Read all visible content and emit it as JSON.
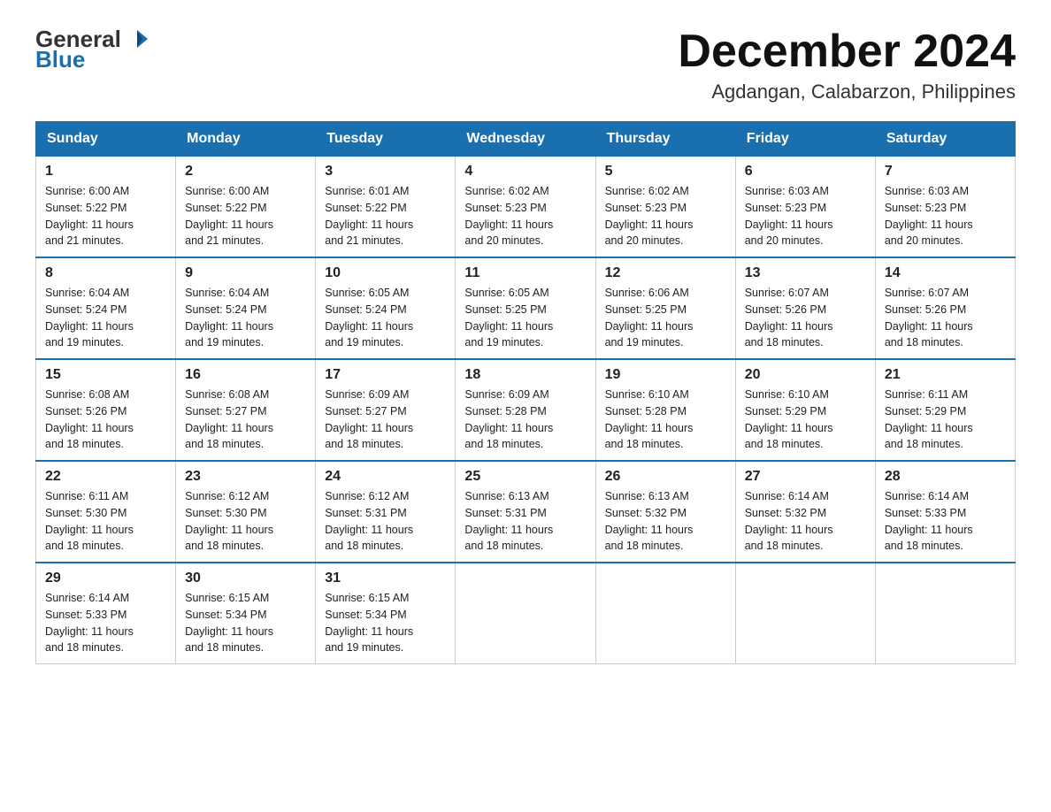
{
  "header": {
    "logo_general": "General",
    "logo_blue": "Blue",
    "title": "December 2024",
    "subtitle": "Agdangan, Calabarzon, Philippines"
  },
  "days_of_week": [
    "Sunday",
    "Monday",
    "Tuesday",
    "Wednesday",
    "Thursday",
    "Friday",
    "Saturday"
  ],
  "weeks": [
    [
      {
        "day": "1",
        "sunrise": "6:00 AM",
        "sunset": "5:22 PM",
        "daylight": "11 hours and 21 minutes."
      },
      {
        "day": "2",
        "sunrise": "6:00 AM",
        "sunset": "5:22 PM",
        "daylight": "11 hours and 21 minutes."
      },
      {
        "day": "3",
        "sunrise": "6:01 AM",
        "sunset": "5:22 PM",
        "daylight": "11 hours and 21 minutes."
      },
      {
        "day": "4",
        "sunrise": "6:02 AM",
        "sunset": "5:23 PM",
        "daylight": "11 hours and 20 minutes."
      },
      {
        "day": "5",
        "sunrise": "6:02 AM",
        "sunset": "5:23 PM",
        "daylight": "11 hours and 20 minutes."
      },
      {
        "day": "6",
        "sunrise": "6:03 AM",
        "sunset": "5:23 PM",
        "daylight": "11 hours and 20 minutes."
      },
      {
        "day": "7",
        "sunrise": "6:03 AM",
        "sunset": "5:23 PM",
        "daylight": "11 hours and 20 minutes."
      }
    ],
    [
      {
        "day": "8",
        "sunrise": "6:04 AM",
        "sunset": "5:24 PM",
        "daylight": "11 hours and 19 minutes."
      },
      {
        "day": "9",
        "sunrise": "6:04 AM",
        "sunset": "5:24 PM",
        "daylight": "11 hours and 19 minutes."
      },
      {
        "day": "10",
        "sunrise": "6:05 AM",
        "sunset": "5:24 PM",
        "daylight": "11 hours and 19 minutes."
      },
      {
        "day": "11",
        "sunrise": "6:05 AM",
        "sunset": "5:25 PM",
        "daylight": "11 hours and 19 minutes."
      },
      {
        "day": "12",
        "sunrise": "6:06 AM",
        "sunset": "5:25 PM",
        "daylight": "11 hours and 19 minutes."
      },
      {
        "day": "13",
        "sunrise": "6:07 AM",
        "sunset": "5:26 PM",
        "daylight": "11 hours and 18 minutes."
      },
      {
        "day": "14",
        "sunrise": "6:07 AM",
        "sunset": "5:26 PM",
        "daylight": "11 hours and 18 minutes."
      }
    ],
    [
      {
        "day": "15",
        "sunrise": "6:08 AM",
        "sunset": "5:26 PM",
        "daylight": "11 hours and 18 minutes."
      },
      {
        "day": "16",
        "sunrise": "6:08 AM",
        "sunset": "5:27 PM",
        "daylight": "11 hours and 18 minutes."
      },
      {
        "day": "17",
        "sunrise": "6:09 AM",
        "sunset": "5:27 PM",
        "daylight": "11 hours and 18 minutes."
      },
      {
        "day": "18",
        "sunrise": "6:09 AM",
        "sunset": "5:28 PM",
        "daylight": "11 hours and 18 minutes."
      },
      {
        "day": "19",
        "sunrise": "6:10 AM",
        "sunset": "5:28 PM",
        "daylight": "11 hours and 18 minutes."
      },
      {
        "day": "20",
        "sunrise": "6:10 AM",
        "sunset": "5:29 PM",
        "daylight": "11 hours and 18 minutes."
      },
      {
        "day": "21",
        "sunrise": "6:11 AM",
        "sunset": "5:29 PM",
        "daylight": "11 hours and 18 minutes."
      }
    ],
    [
      {
        "day": "22",
        "sunrise": "6:11 AM",
        "sunset": "5:30 PM",
        "daylight": "11 hours and 18 minutes."
      },
      {
        "day": "23",
        "sunrise": "6:12 AM",
        "sunset": "5:30 PM",
        "daylight": "11 hours and 18 minutes."
      },
      {
        "day": "24",
        "sunrise": "6:12 AM",
        "sunset": "5:31 PM",
        "daylight": "11 hours and 18 minutes."
      },
      {
        "day": "25",
        "sunrise": "6:13 AM",
        "sunset": "5:31 PM",
        "daylight": "11 hours and 18 minutes."
      },
      {
        "day": "26",
        "sunrise": "6:13 AM",
        "sunset": "5:32 PM",
        "daylight": "11 hours and 18 minutes."
      },
      {
        "day": "27",
        "sunrise": "6:14 AM",
        "sunset": "5:32 PM",
        "daylight": "11 hours and 18 minutes."
      },
      {
        "day": "28",
        "sunrise": "6:14 AM",
        "sunset": "5:33 PM",
        "daylight": "11 hours and 18 minutes."
      }
    ],
    [
      {
        "day": "29",
        "sunrise": "6:14 AM",
        "sunset": "5:33 PM",
        "daylight": "11 hours and 18 minutes."
      },
      {
        "day": "30",
        "sunrise": "6:15 AM",
        "sunset": "5:34 PM",
        "daylight": "11 hours and 18 minutes."
      },
      {
        "day": "31",
        "sunrise": "6:15 AM",
        "sunset": "5:34 PM",
        "daylight": "11 hours and 19 minutes."
      },
      null,
      null,
      null,
      null
    ]
  ],
  "sunrise_label": "Sunrise:",
  "sunset_label": "Sunset:",
  "daylight_label": "Daylight:"
}
